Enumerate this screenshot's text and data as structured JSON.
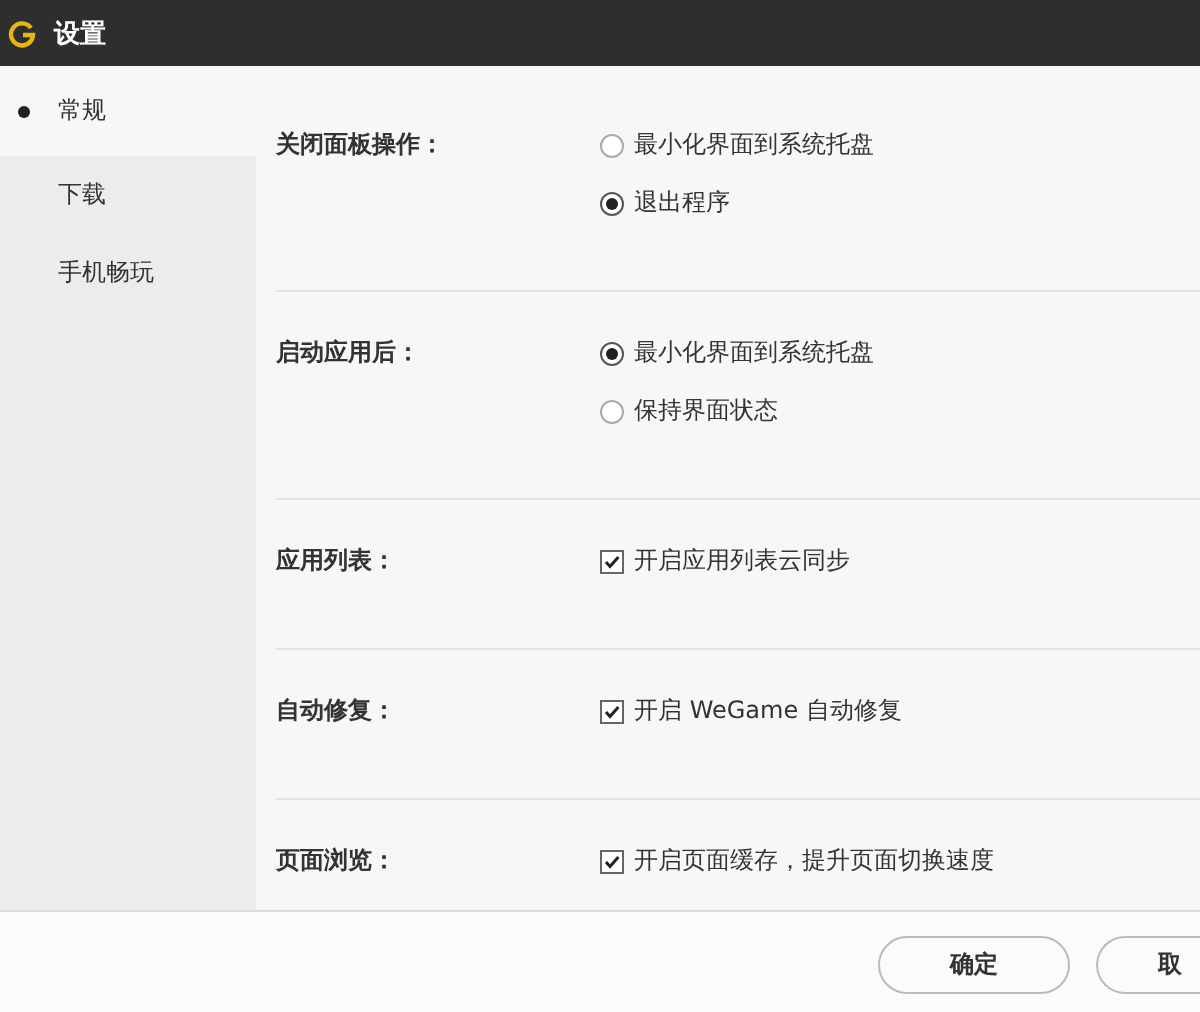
{
  "window": {
    "title": "设置"
  },
  "sidebar": {
    "items": [
      {
        "label": "常规",
        "selected": true
      },
      {
        "label": "下载",
        "selected": false
      },
      {
        "label": "手机畅玩",
        "selected": false
      }
    ]
  },
  "sections": [
    {
      "label": "关闭面板操作：",
      "kind": "radio",
      "options": [
        {
          "label": "最小化界面到系统托盘",
          "selected": false
        },
        {
          "label": "退出程序",
          "selected": true
        }
      ]
    },
    {
      "label": "启动应用后：",
      "kind": "radio",
      "options": [
        {
          "label": "最小化界面到系统托盘",
          "selected": true
        },
        {
          "label": "保持界面状态",
          "selected": false
        }
      ]
    },
    {
      "label": "应用列表：",
      "kind": "checkbox",
      "options": [
        {
          "label": "开启应用列表云同步",
          "checked": true
        }
      ]
    },
    {
      "label": "自动修复：",
      "kind": "checkbox",
      "options": [
        {
          "label": "开启 WeGame 自动修复",
          "checked": true
        }
      ]
    },
    {
      "label": "页面浏览：",
      "kind": "checkbox",
      "options": [
        {
          "label": "开启页面缓存，提升页面切换速度",
          "checked": true
        }
      ]
    }
  ],
  "buttons": [
    "确定",
    "取"
  ]
}
